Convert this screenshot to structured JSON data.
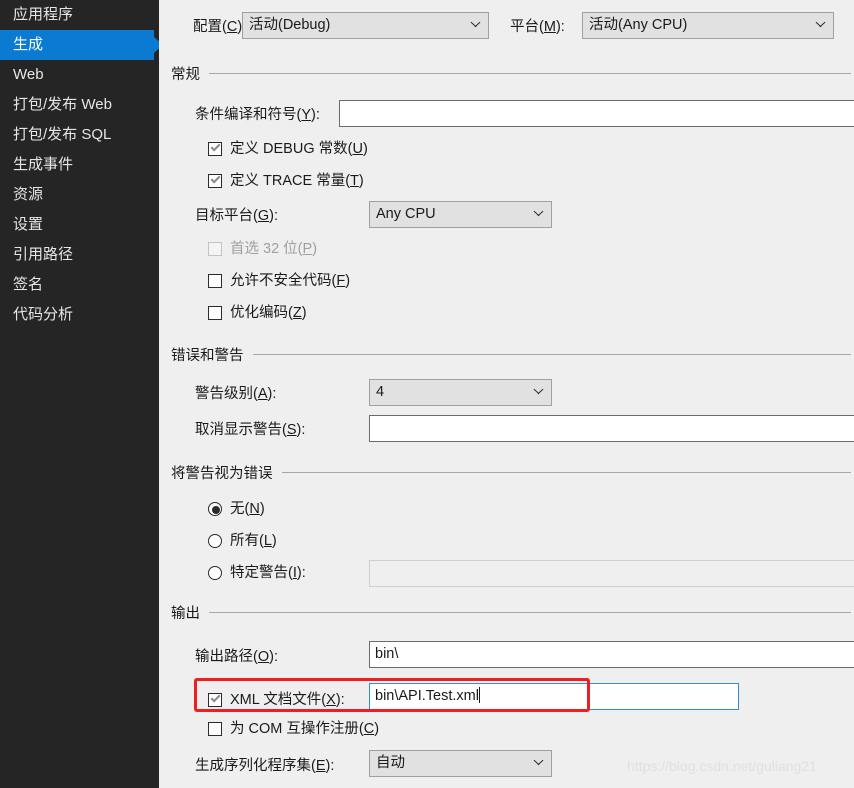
{
  "sidebar": {
    "items": [
      {
        "label": "应用程序",
        "selected": false
      },
      {
        "label": "生成",
        "selected": true
      },
      {
        "label": "Web",
        "selected": false
      },
      {
        "label": "打包/发布 Web",
        "selected": false
      },
      {
        "label": "打包/发布 SQL",
        "selected": false
      },
      {
        "label": "生成事件",
        "selected": false
      },
      {
        "label": "资源",
        "selected": false
      },
      {
        "label": "设置",
        "selected": false
      },
      {
        "label": "引用路径",
        "selected": false
      },
      {
        "label": "签名",
        "selected": false
      },
      {
        "label": "代码分析",
        "selected": false
      }
    ],
    "selected_color": "#0a7bd0",
    "background_color": "#252526"
  },
  "top_bar": {
    "configuration_label": "配置(C):",
    "configuration_value": "活动(Debug)",
    "platform_label": "平台(M):",
    "platform_value": "活动(Any CPU)"
  },
  "general": {
    "title": "常规",
    "conditional_symbols_label": "条件编译和符号(Y):",
    "conditional_symbols_value": "",
    "define_debug_label": "定义 DEBUG 常数(U)",
    "define_debug_checked": true,
    "define_trace_label": "定义 TRACE 常量(T)",
    "define_trace_checked": true,
    "target_platform_label": "目标平台(G):",
    "target_platform_value": "Any CPU",
    "prefer_32bit_label": "首选 32 位(P)",
    "prefer_32bit_checked": false,
    "prefer_32bit_disabled": true,
    "allow_unsafe_label": "允许不安全代码(F)",
    "allow_unsafe_checked": false,
    "optimize_label": "优化编码(Z)",
    "optimize_checked": false
  },
  "errors_warnings": {
    "title": "错误和警告",
    "warning_level_label": "警告级别(A):",
    "warning_level_value": "4",
    "suppress_warnings_label": "取消显示警告(S):",
    "suppress_warnings_value": ""
  },
  "treat_warnings": {
    "title": "将警告视为错误",
    "none_label": "无(N)",
    "none_selected": true,
    "all_label": "所有(L)",
    "all_selected": false,
    "specific_label": "特定警告(I):",
    "specific_selected": false,
    "specific_value": ""
  },
  "output": {
    "title": "输出",
    "output_path_label": "输出路径(O):",
    "output_path_value": "bin\\",
    "xml_doc_label": "XML 文档文件(X):",
    "xml_doc_checked": true,
    "xml_doc_value": "bin\\API.Test.xml",
    "register_com_label": "为 COM 互操作注册(C)",
    "register_com_checked": false,
    "serialization_label": "生成序列化程序集(E):",
    "serialization_value": "自动"
  },
  "annotation": {
    "highlight_color": "#f01f1f"
  },
  "watermark": {
    "text": "https://blog.csdn.net/guliang21"
  }
}
